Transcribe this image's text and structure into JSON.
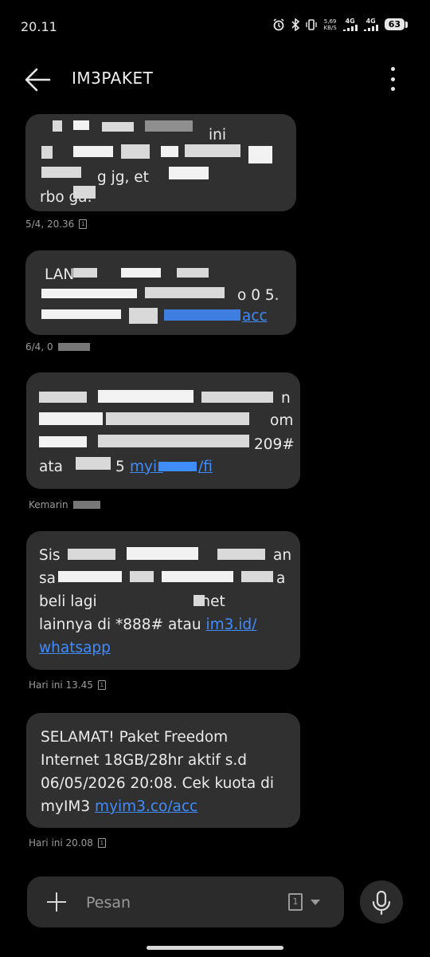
{
  "status_bar": {
    "time": "20.11",
    "net_speed_value": "5,69",
    "net_speed_unit": "KB/S",
    "network1": "4G",
    "network2": "4G",
    "battery": "63"
  },
  "header": {
    "title": "IM3PAKET"
  },
  "messages": [
    {
      "line1": "",
      "line2": "ini",
      "line3": "",
      "line4": "g jg,         et",
      "line5": "rbo     ga.",
      "timestamp": "5/4, 20.36"
    },
    {
      "line1": "LAN",
      "line2": "o 0   5.",
      "line3_link": "acc",
      "timestamp": "6/4, 0"
    },
    {
      "line2": "n",
      "line3": "om",
      "line4": "209#",
      "line5_prefix": "ata",
      "line5_mid": "5",
      "line5_link1": "myir",
      "line5_link2": "/fi",
      "timestamp": "Kemarin"
    },
    {
      "line1_a": "Sis",
      "line1_b": "an",
      "line2_a": "sa",
      "line2_b": "a",
      "line3": "beli lagi                     rnet",
      "line4_text": "lainnya di *888# atau ",
      "line4_link": "im3.id/",
      "line5_link": "whatsapp",
      "timestamp": "Hari ini 13.45"
    },
    {
      "line1": "SELAMAT! Paket Freedom",
      "line2": "Internet 18GB/28hr aktif s.d",
      "line3": "06/05/2026 20:08. Cek kuota di",
      "line4_text": "myIM3 ",
      "line4_link": "myim3.co/acc",
      "timestamp": "Hari ini 20.08"
    }
  ],
  "composer": {
    "placeholder": "Pesan",
    "sim_number": "1"
  },
  "icons": {
    "back": "arrow-left-icon",
    "more": "more-vertical-icon",
    "plus": "plus-icon",
    "sim": "sim-card-icon",
    "mic": "microphone-icon"
  },
  "colors": {
    "background": "#000000",
    "bubble": "#303030",
    "link": "#3f8cff",
    "meta_text": "#9a9a9a"
  }
}
